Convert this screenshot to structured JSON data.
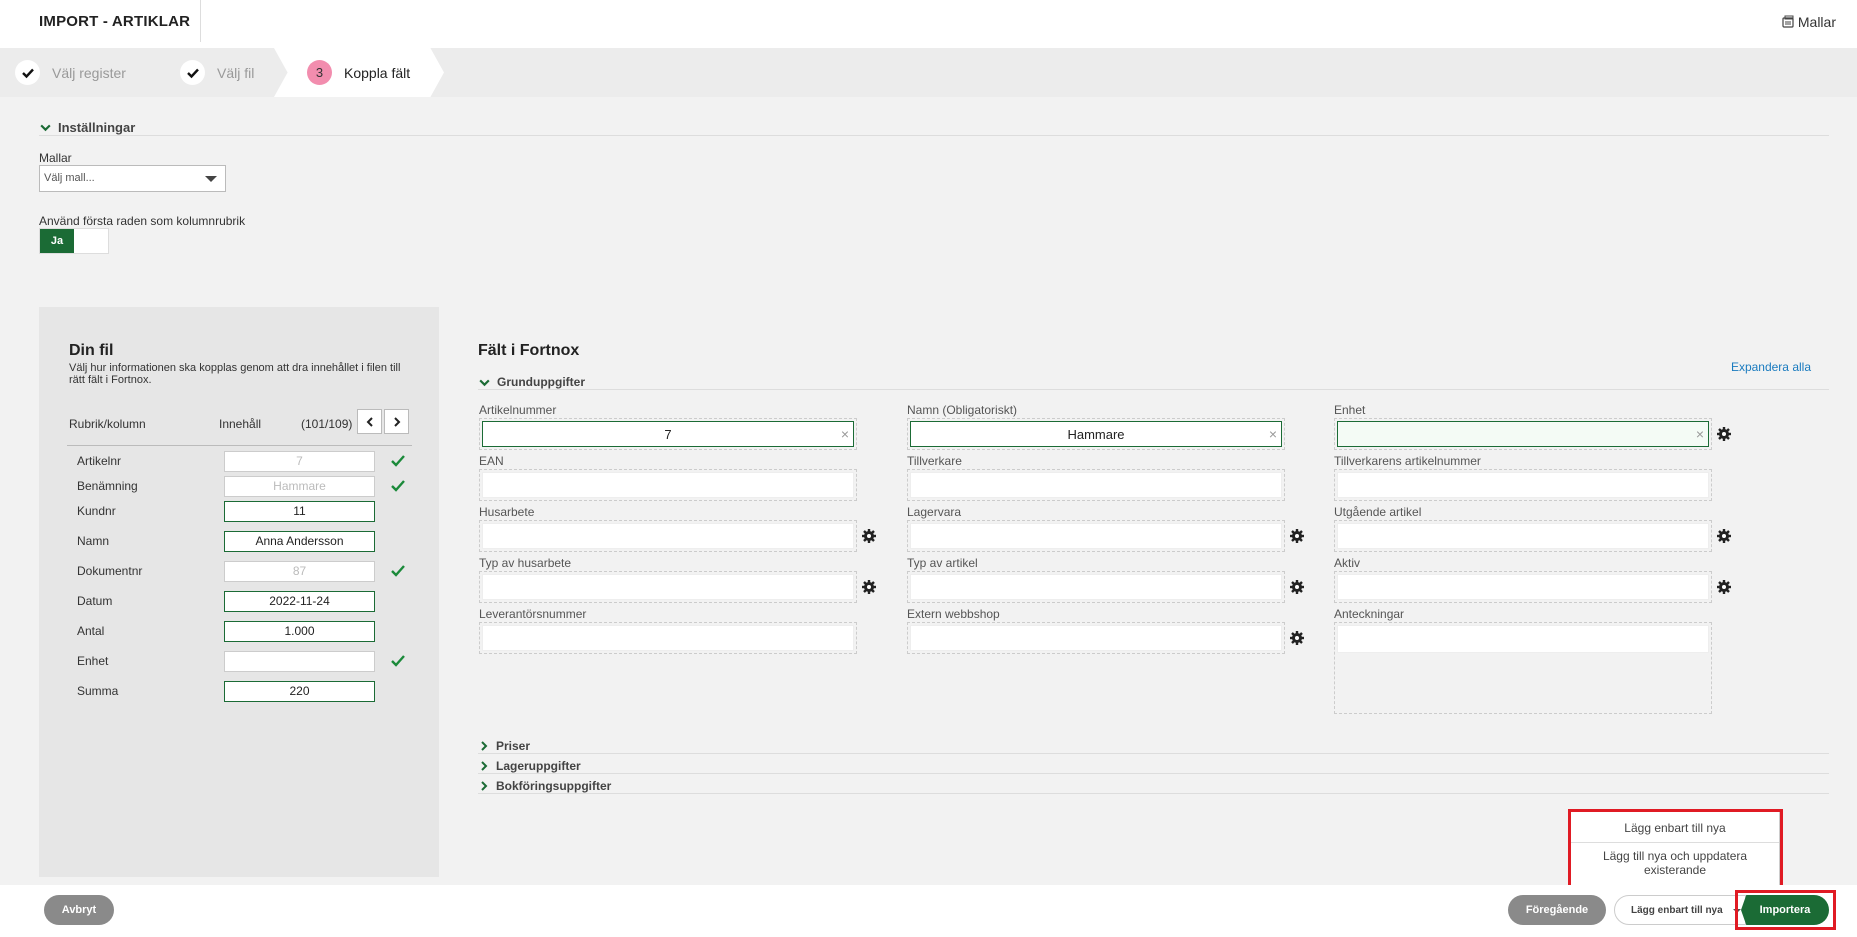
{
  "header": {
    "title": "IMPORT - ARTIKLAR",
    "templates_link": "Mallar"
  },
  "steps": [
    {
      "label": "Välj register",
      "state": "done"
    },
    {
      "label": "Välj fil",
      "state": "done"
    },
    {
      "label": "Koppla fält",
      "number": "3",
      "state": "active"
    }
  ],
  "settings": {
    "title": "Inställningar",
    "templates_label": "Mallar",
    "templates_select": "Välj mall...",
    "first_row_label": "Använd första raden som kolumnrubrik",
    "toggle_on": "Ja"
  },
  "your_file": {
    "title": "Din fil",
    "description": "Välj hur informationen ska kopplas genom att dra innehållet i filen till rätt fält i Fortnox.",
    "col_header": "Rubrik/kolumn",
    "content_header": "Innehåll",
    "pager": "(101/109)",
    "rows": [
      {
        "name": "Artikelnr",
        "value": "7",
        "mapped": true
      },
      {
        "name": "Benämning",
        "value": "Hammare",
        "mapped": true
      },
      {
        "name": "Kundnr",
        "value": "11",
        "mapped": false
      },
      {
        "name": "Namn",
        "value": "Anna Andersson",
        "mapped": false
      },
      {
        "name": "Dokumentnr",
        "value": "87",
        "mapped": true
      },
      {
        "name": "Datum",
        "value": "2022-11-24",
        "mapped": false
      },
      {
        "name": "Antal",
        "value": "1.000",
        "mapped": false
      },
      {
        "name": "Enhet",
        "value": "",
        "mapped": true
      },
      {
        "name": "Summa",
        "value": "220",
        "mapped": false
      }
    ]
  },
  "fortnox_fields": {
    "title": "Fält i Fortnox",
    "expand_all": "Expandera alla",
    "section_basic": "Grunduppgifter",
    "fields": {
      "artikelnummer": {
        "label": "Artikelnummer",
        "value": "7"
      },
      "namn": {
        "label": "Namn (Obligatoriskt)",
        "value": "Hammare"
      },
      "enhet": {
        "label": "Enhet",
        "value": ""
      },
      "ean": {
        "label": "EAN",
        "value": ""
      },
      "tillverkare": {
        "label": "Tillverkare",
        "value": ""
      },
      "tillverkarens_artikelnummer": {
        "label": "Tillverkarens artikelnummer",
        "value": ""
      },
      "husarbete": {
        "label": "Husarbete",
        "value": ""
      },
      "lagervara": {
        "label": "Lagervara",
        "value": ""
      },
      "utgaende_artikel": {
        "label": "Utgående artikel",
        "value": ""
      },
      "typ_av_husarbete": {
        "label": "Typ av husarbete",
        "value": ""
      },
      "typ_av_artikel": {
        "label": "Typ av artikel",
        "value": ""
      },
      "aktiv": {
        "label": "Aktiv",
        "value": ""
      },
      "leverantorsnummer": {
        "label": "Leverantörsnummer",
        "value": ""
      },
      "extern_webbshop": {
        "label": "Extern webbshop",
        "value": ""
      },
      "anteckningar": {
        "label": "Anteckningar",
        "value": ""
      }
    },
    "sections_collapsed": [
      "Priser",
      "Lageruppgifter",
      "Bokföringsuppgifter"
    ]
  },
  "import_menu": {
    "options": [
      "Lägg enbart till nya",
      "Lägg till nya och uppdatera existerande"
    ]
  },
  "footer": {
    "cancel": "Avbryt",
    "previous": "Föregående",
    "import_mode": "Lägg enbart till nya",
    "import": "Importera"
  },
  "colors": {
    "brand_green": "#1b6b35",
    "step_badge": "#f28dae",
    "highlight_red": "#e01b24",
    "link_blue": "#1a7bbf"
  }
}
